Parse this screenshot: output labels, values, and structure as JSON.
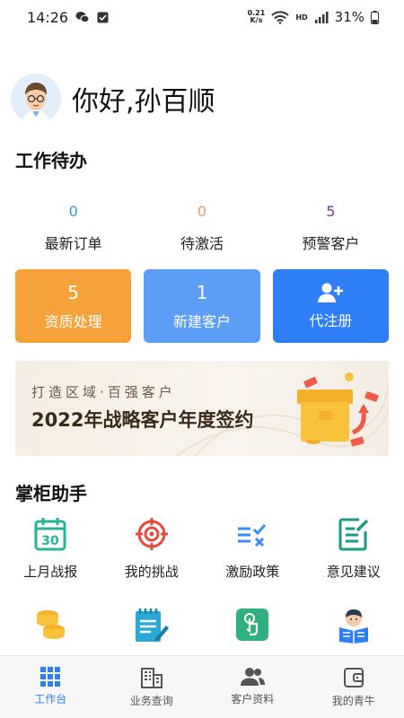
{
  "status_bar": {
    "time": "14:26",
    "speed_top": "0.21",
    "speed_bottom": "K/s",
    "hd": "HD",
    "battery": "31%"
  },
  "greeting": {
    "text": "你好,孙百顺"
  },
  "todo": {
    "title": "工作待办",
    "items": [
      {
        "count": "0",
        "label": "最新订单",
        "color": "#2e9de6"
      },
      {
        "count": "0",
        "label": "待激活",
        "color": "#f0956a"
      },
      {
        "count": "5",
        "label": "预警客户",
        "color": "#6a3fa0"
      }
    ]
  },
  "cards": [
    {
      "num": "5",
      "label": "资质处理",
      "color": "#f6a23a"
    },
    {
      "num": "1",
      "label": "新建客户",
      "color": "#5c9df6"
    },
    {
      "num": "",
      "label": "代注册",
      "color": "#2d7ef7",
      "icon": "add-user-icon"
    }
  ],
  "banner": {
    "subtitle": "打造区域·百强客户",
    "title": "2022年战略客户年度签约"
  },
  "helper": {
    "title": "掌柜助手",
    "tools": [
      {
        "label": "上月战报",
        "icon": "calendar-icon"
      },
      {
        "label": "我的挑战",
        "icon": "target-icon"
      },
      {
        "label": "激励政策",
        "icon": "policy-list-icon"
      },
      {
        "label": "意见建议",
        "icon": "feedback-edit-icon"
      }
    ],
    "tools_row2_icons": [
      "coins-icon",
      "notepad-icon",
      "touch-icon",
      "reader-icon"
    ]
  },
  "tabbar": [
    {
      "label": "工作台",
      "icon": "grid-icon",
      "active": true
    },
    {
      "label": "业务查询",
      "icon": "building-icon",
      "active": false
    },
    {
      "label": "客户资料",
      "icon": "users-icon",
      "active": false
    },
    {
      "label": "我的青牛",
      "icon": "wallet-icon",
      "active": false
    }
  ]
}
